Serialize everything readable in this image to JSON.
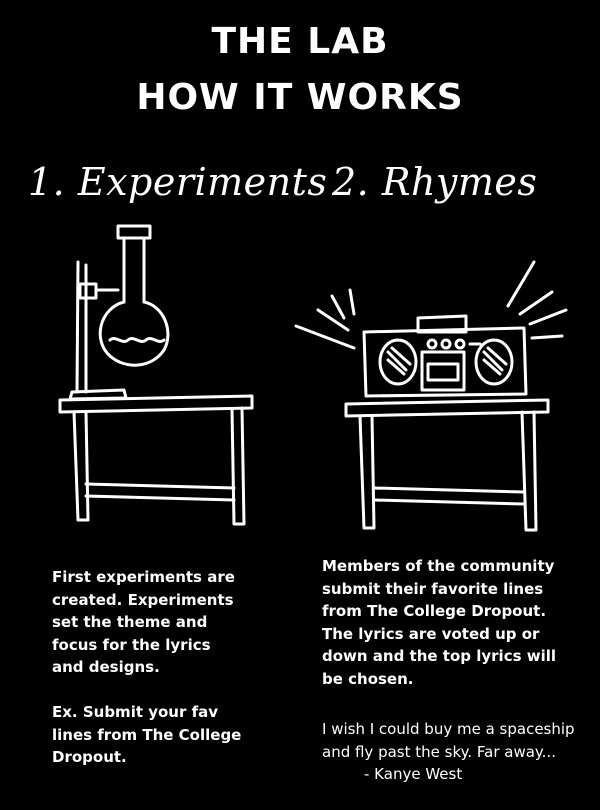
{
  "header": {
    "line1": "THE LAB",
    "line2": "HOW IT WORKS"
  },
  "steps": [
    {
      "label": "1. Experiments"
    },
    {
      "label": "2. Rhymes"
    }
  ],
  "left_text": {
    "paragraph": [
      "First experiments are",
      "created.  Experiments",
      "set the theme and",
      "focus for the lyrics",
      "and designs."
    ],
    "example": [
      "Ex. Submit your fav",
      "lines from The College",
      "Dropout."
    ]
  },
  "right_text": {
    "paragraph": [
      "Members of the community",
      "submit their favorite lines",
      "from The College Dropout.",
      "The lyrics are voted up or",
      "down and the top lyrics will",
      "be chosen."
    ],
    "quote": [
      "I wish I could buy me a spaceship",
      "and fly past the sky.  Far away...",
      "- Kanye West"
    ]
  }
}
